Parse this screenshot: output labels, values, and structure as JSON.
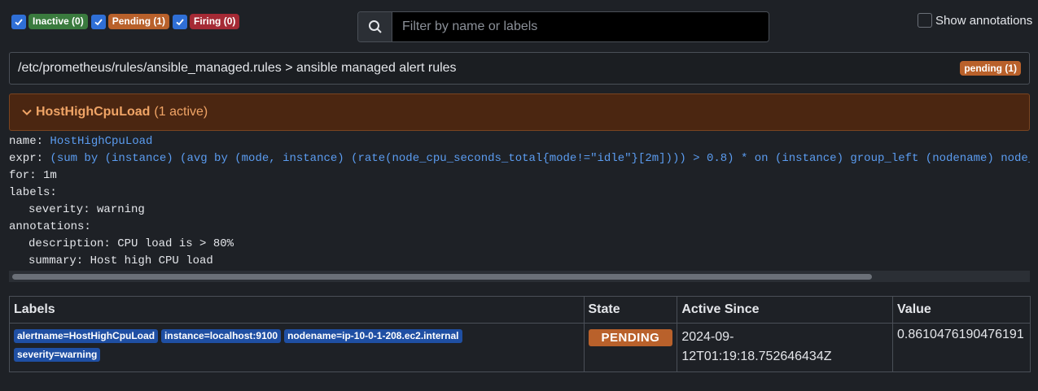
{
  "filters": [
    {
      "label": "Inactive (0)",
      "checked": true,
      "color": "#3a7b3e"
    },
    {
      "label": "Pending (1)",
      "checked": true,
      "color": "#b9612b"
    },
    {
      "label": "Firing (0)",
      "checked": true,
      "color": "#a52a35"
    }
  ],
  "search": {
    "placeholder": "Filter by name or labels",
    "value": ""
  },
  "annotations_toggle": {
    "label": "Show annotations",
    "checked": false
  },
  "group": {
    "title": "/etc/prometheus/rules/ansible_managed.rules > ansible managed alert rules",
    "badge": "pending (1)"
  },
  "rule": {
    "name": "HostHighCpuLoad",
    "active": "(1 active)",
    "details": {
      "name_key": "name: ",
      "name_val": "HostHighCpuLoad",
      "expr_key": "expr: ",
      "expr_val": "(sum by (instance) (avg by (mode, instance) (rate(node_cpu_seconds_total{mode!=\"idle\"}[2m]))) > 0.8) * on (instance) group_left (nodename) node_uname_info{nodename=~\".+\"}",
      "for_line": "for: 1m",
      "labels_key": "labels:",
      "severity_line": "severity: warning",
      "annotations_key": "annotations:",
      "description_line": "description: CPU load is > 80%",
      "summary_line": "summary: Host high CPU load"
    }
  },
  "table": {
    "headers": [
      "Labels",
      "State",
      "Active Since",
      "Value"
    ],
    "rows": [
      {
        "labels": [
          "alertname=HostHighCpuLoad",
          "instance=localhost:9100",
          "nodename=ip-10-0-1-208.ec2.internal",
          "severity=warning"
        ],
        "state": "PENDING",
        "active_since_1": "2024-09-",
        "active_since_2": "12T01:19:18.752646434Z",
        "value": "0.8610476190476191"
      }
    ]
  },
  "colors": {
    "background": "#1e2126",
    "accent_blue": "#5b9cf0",
    "pending": "#b9612b",
    "rule_header_bg": "#4b2611",
    "label_chip": "#1f4fa3"
  }
}
